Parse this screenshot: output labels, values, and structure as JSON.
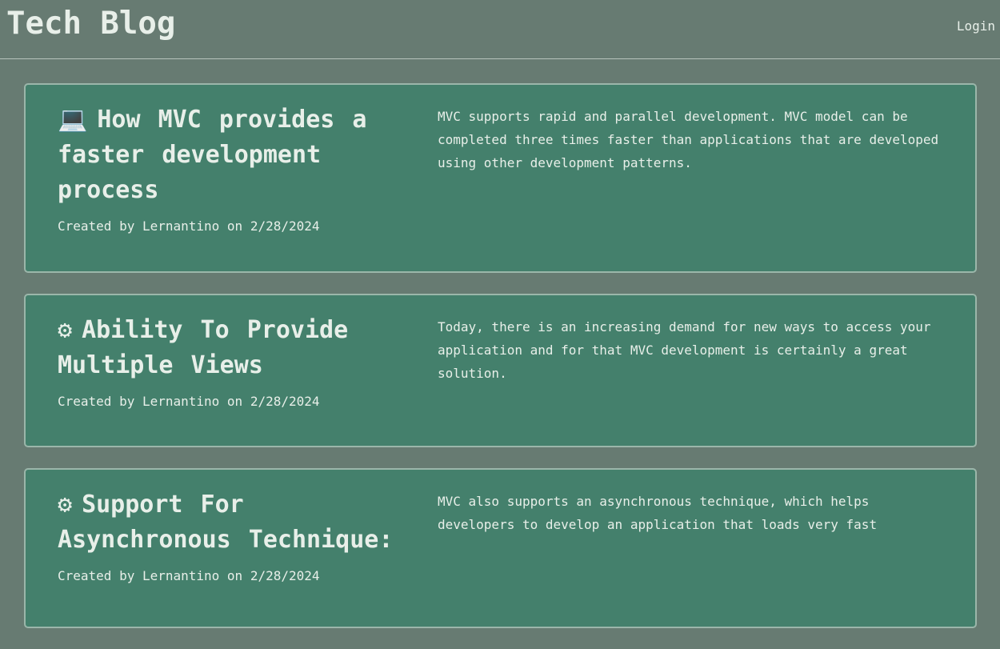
{
  "header": {
    "brand": "Tech Blog",
    "login_label": "Login"
  },
  "posts": [
    {
      "icon": "laptop-icon",
      "icon_glyph": "💻",
      "title": "How MVC provides a faster development process",
      "meta": "Created by Lernantino on 2/28/2024",
      "body": "MVC supports rapid and parallel development. MVC model can be completed three times faster than applications that are developed using other development patterns."
    },
    {
      "icon": "gear-icon",
      "icon_glyph": "⚙",
      "title": "Ability To Provide Multiple Views",
      "meta": "Created by Lernantino on 2/28/2024",
      "body": "Today, there is an increasing demand for new ways to access your application and for that MVC development is certainly a great solution."
    },
    {
      "icon": "gear-icon",
      "icon_glyph": "⚙",
      "title": "Support For Asynchronous Technique:",
      "meta": "Created by Lernantino on 2/28/2024",
      "body": "MVC also supports an asynchronous technique, which helps developers to develop an application that loads very fast"
    }
  ]
}
